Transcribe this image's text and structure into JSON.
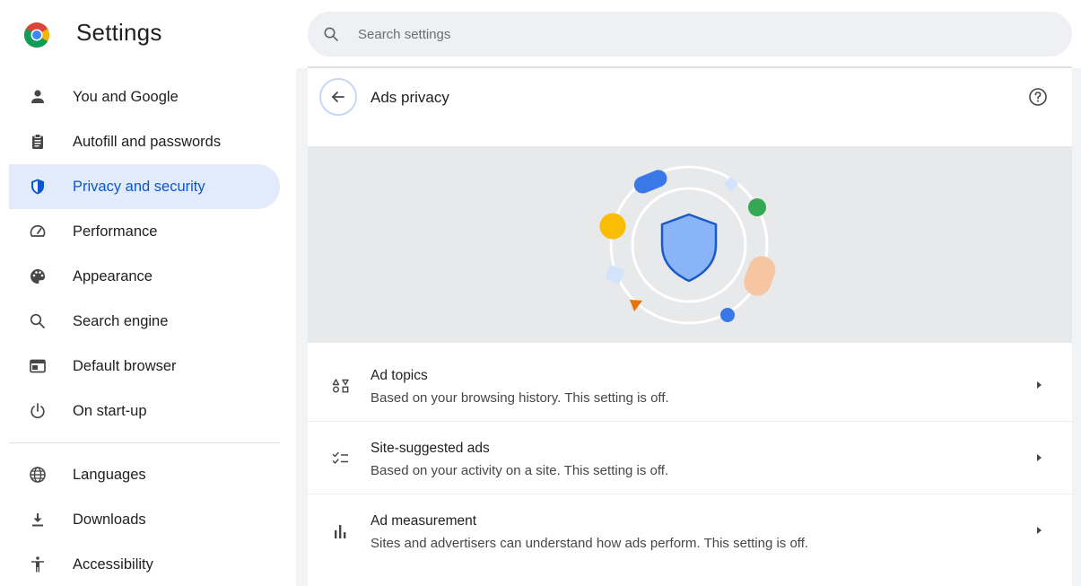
{
  "header": {
    "app_title": "Settings",
    "logo_icon": "chrome-logo-icon",
    "search": {
      "placeholder": "Search settings",
      "value": ""
    }
  },
  "sidebar": {
    "items": [
      {
        "label": "You and Google",
        "icon": "person-icon",
        "active": false
      },
      {
        "label": "Autofill and passwords",
        "icon": "clipboard-icon",
        "active": false
      },
      {
        "label": "Privacy and security",
        "icon": "shield-icon",
        "active": true
      },
      {
        "label": "Performance",
        "icon": "speedometer-icon",
        "active": false
      },
      {
        "label": "Appearance",
        "icon": "palette-icon",
        "active": false
      },
      {
        "label": "Search engine",
        "icon": "search-icon",
        "active": false
      },
      {
        "label": "Default browser",
        "icon": "browser-window-icon",
        "active": false
      },
      {
        "label": "On start-up",
        "icon": "power-icon",
        "active": false
      },
      {
        "label": "Languages",
        "icon": "globe-icon",
        "active": false
      },
      {
        "label": "Downloads",
        "icon": "download-icon",
        "active": false
      },
      {
        "label": "Accessibility",
        "icon": "accessibility-icon",
        "active": false
      }
    ]
  },
  "main": {
    "page_title": "Ads privacy",
    "rows": [
      {
        "title": "Ad topics",
        "subtitle": "Based on your browsing history. This setting is off.",
        "icon": "ad-topics-icon"
      },
      {
        "title": "Site-suggested ads",
        "subtitle": "Based on your activity on a site. This setting is off.",
        "icon": "checklist-icon"
      },
      {
        "title": "Ad measurement",
        "subtitle": "Sites and advertisers can understand how ads perform. This setting is off.",
        "icon": "bar-chart-icon"
      }
    ]
  },
  "colors": {
    "accent": "#0b57d0",
    "active_nav_bg": "#e2ebfb",
    "hero_bg": "#e8e9eb",
    "shield_fill": "#8ab4f8",
    "shield_stroke": "#1a5ac8"
  }
}
